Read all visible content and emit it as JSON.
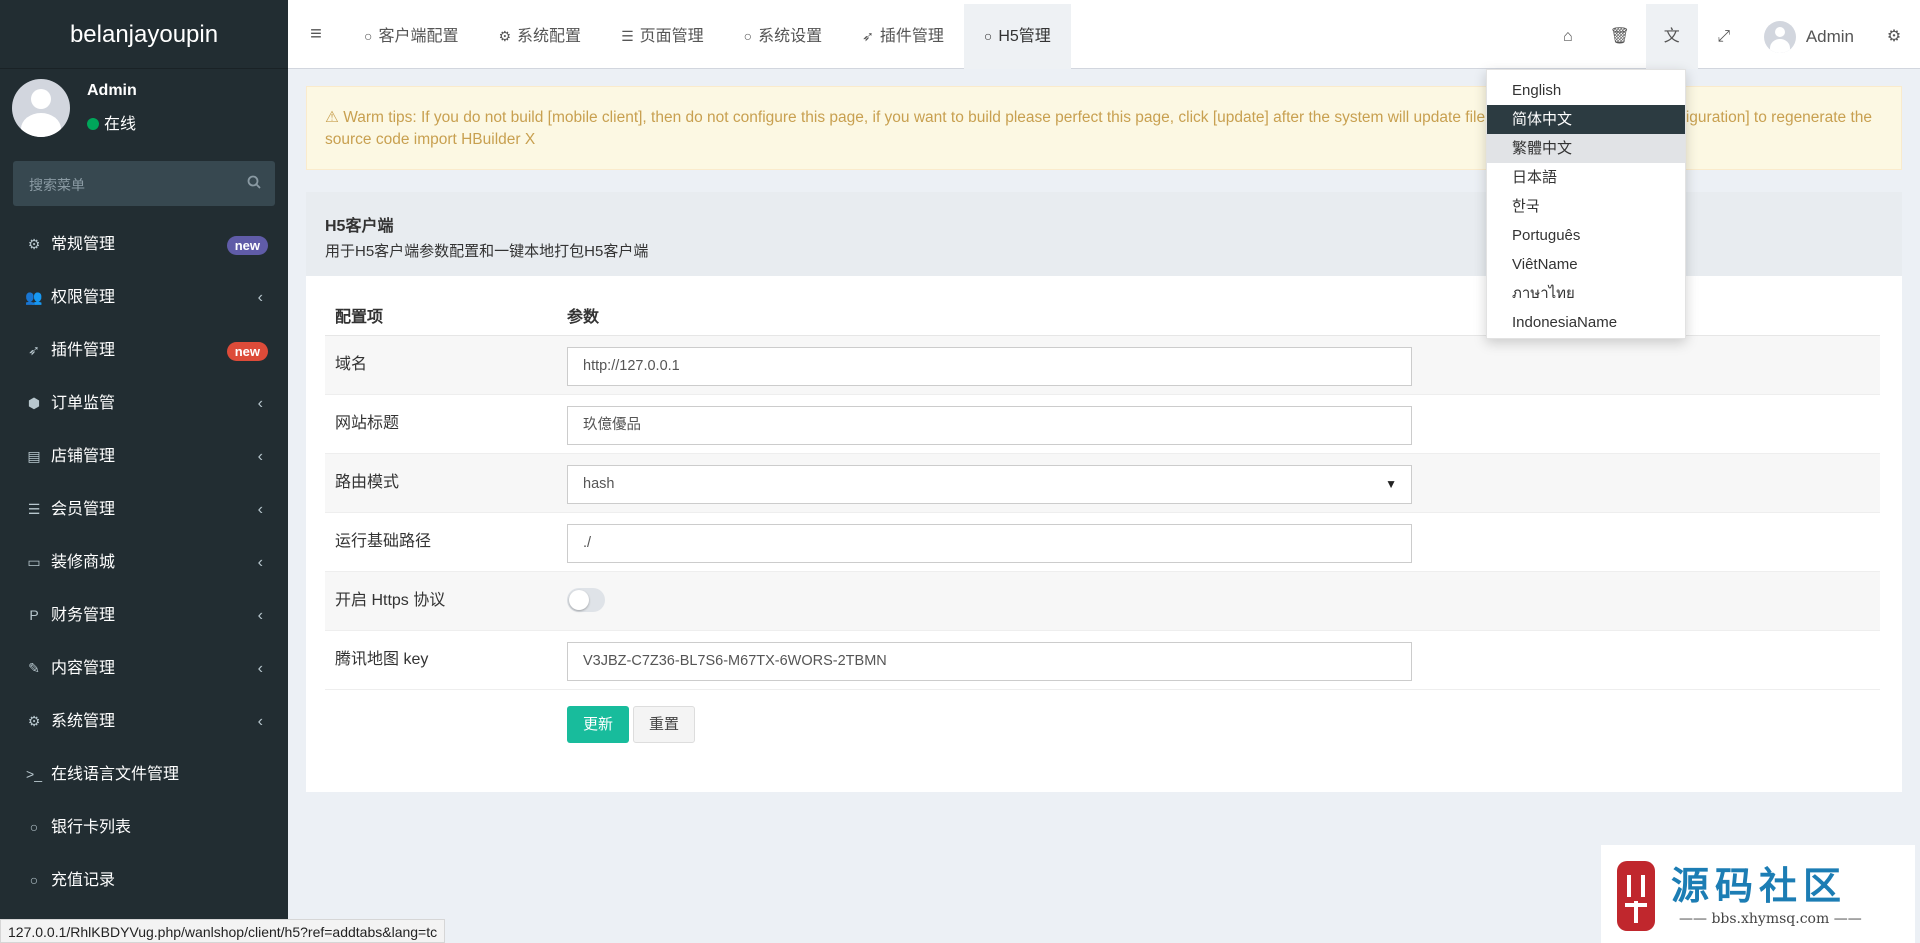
{
  "sidebar": {
    "brand": "belanjayoupin",
    "user": {
      "name": "Admin",
      "status": "在线"
    },
    "search_placeholder": "搜索菜单",
    "items": [
      {
        "label": "常规管理",
        "icon": "cogs-icon",
        "badge": "new",
        "badge_color": "#605ca8"
      },
      {
        "label": "权限管理",
        "icon": "users-icon",
        "chevron": "‹"
      },
      {
        "label": "插件管理",
        "icon": "rocket-icon",
        "badge": "new",
        "badge_color": "#dd4b39"
      },
      {
        "label": "订单监管",
        "icon": "cube-icon",
        "chevron": "‹"
      },
      {
        "label": "店铺管理",
        "icon": "archive-icon",
        "chevron": "‹"
      },
      {
        "label": "会员管理",
        "icon": "list-icon",
        "chevron": "‹"
      },
      {
        "label": "装修商城",
        "icon": "desktop-icon",
        "chevron": "‹"
      },
      {
        "label": "财务管理",
        "icon": "paypal-icon",
        "chevron": "‹"
      },
      {
        "label": "内容管理",
        "icon": "edit-icon",
        "chevron": "‹"
      },
      {
        "label": "系统管理",
        "icon": "gear-icon",
        "chevron": "‹"
      },
      {
        "label": "在线语言文件管理",
        "icon": "terminal-icon"
      },
      {
        "label": "银行卡列表",
        "icon": "circle-icon"
      },
      {
        "label": "充值记录",
        "icon": "circle-icon"
      }
    ]
  },
  "header": {
    "tabs": [
      {
        "label": "客户端配置",
        "icon": "circle-icon"
      },
      {
        "label": "系统配置",
        "icon": "gear-icon"
      },
      {
        "label": "页面管理",
        "icon": "list-icon"
      },
      {
        "label": "系统设置",
        "icon": "circle-icon"
      },
      {
        "label": "插件管理",
        "icon": "rocket-icon"
      },
      {
        "label": "H5管理",
        "icon": "circle-icon"
      }
    ],
    "user": "Admin"
  },
  "alert": "Warm tips: If you do not build [mobile client], then do not configure this page, if you want to build please perfect this page, click [update] after the system will update file, update please in [client configuration] to regenerate the source code import HBuilder X",
  "panel": {
    "title": "H5客户端",
    "subtitle": "用于H5客户端参数配置和一键本地打包H5客户端",
    "col_config": "配置项",
    "col_param": "参数",
    "rows": [
      {
        "label": "域名",
        "value": "http://127.0.0.1"
      },
      {
        "label": "网站标题",
        "value": "玖億優品"
      },
      {
        "label": "路由模式",
        "value": "hash"
      },
      {
        "label": "运行基础路径",
        "value": "./"
      },
      {
        "label": "开启 Https 协议",
        "switch_on": false
      },
      {
        "label": "腾讯地图 key",
        "value": "V3JBZ-C7Z36-BL7S6-M67TX-6WORS-2TBMN"
      }
    ],
    "update_button": "更新",
    "reset_button": "重置"
  },
  "languages": [
    "English",
    "简体中文",
    "繁體中文",
    "日本語",
    "한국",
    "Português",
    "ViêtName",
    "ภาษาไทย",
    "IndonesiaName"
  ],
  "selected_language": "简体中文",
  "status_url": "127.0.0.1/RhlKBDYVug.php/wanlshop/client/h5?ref=addtabs&lang=tc",
  "watermark": {
    "title": "源码社区",
    "url": "bbs.xhymsq.com"
  },
  "colors": {
    "sidebar": "#222d32",
    "primary": "#18bc9c",
    "alert_bg": "#fcf8e3",
    "alert_text": "#c8a050"
  }
}
